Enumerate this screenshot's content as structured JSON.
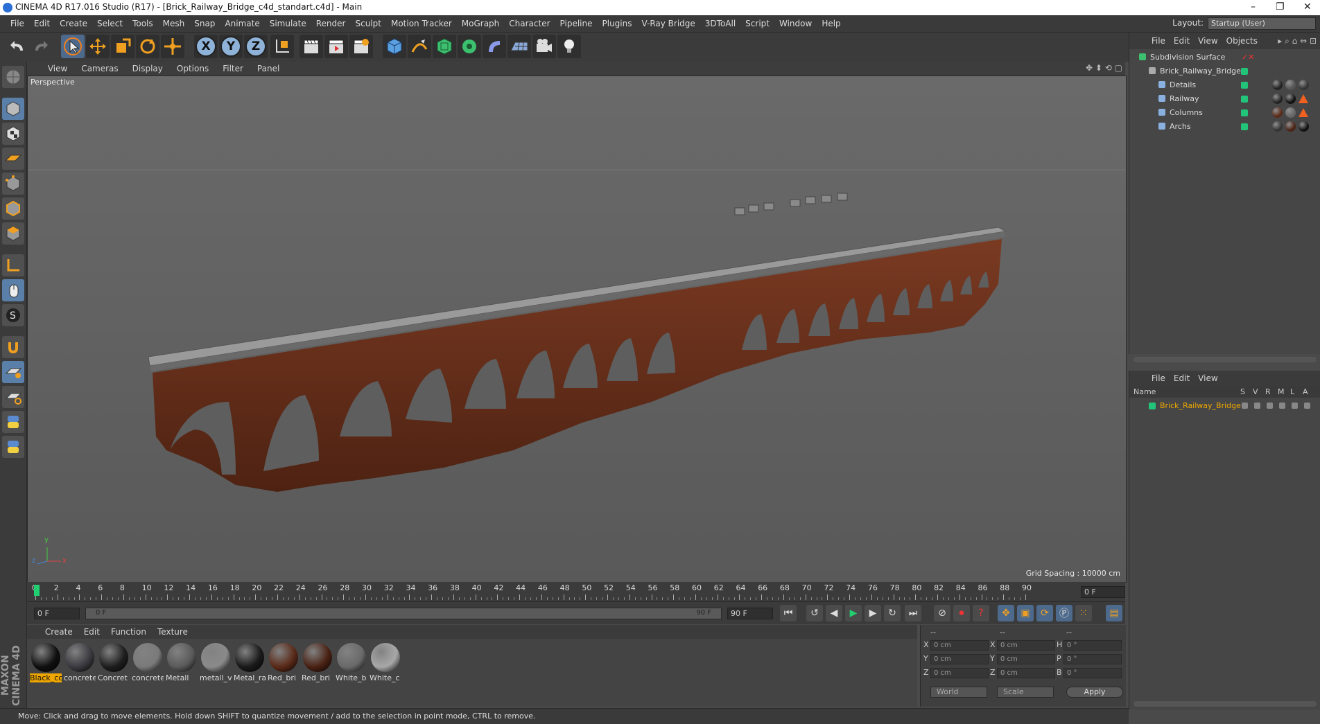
{
  "window": {
    "title": "CINEMA 4D R17.016 Studio (R17) - [Brick_Railway_Bridge_c4d_standart.c4d] - Main",
    "minimize": "–",
    "restore": "❐",
    "close": "✕"
  },
  "menu": [
    "File",
    "Edit",
    "Create",
    "Select",
    "Tools",
    "Mesh",
    "Snap",
    "Animate",
    "Simulate",
    "Render",
    "Sculpt",
    "Motion Tracker",
    "MoGraph",
    "Character",
    "Pipeline",
    "Plugins",
    "V-Ray Bridge",
    "3DToAll",
    "Script",
    "Window",
    "Help"
  ],
  "layout": {
    "label": "Layout:",
    "value": "Startup (User)"
  },
  "toolbar": {
    "x": "X",
    "y": "Y",
    "z": "Z"
  },
  "viewport": {
    "menu": [
      "View",
      "Cameras",
      "Display",
      "Options",
      "Filter",
      "Panel"
    ],
    "camera_label": "Perspective",
    "grid_spacing": "Grid Spacing : 10000 cm",
    "axis_y": "y",
    "axis_z": "z",
    "axis_x": "x"
  },
  "timeline": {
    "ticks": [
      "0",
      "2",
      "4",
      "6",
      "8",
      "10",
      "12",
      "14",
      "16",
      "18",
      "20",
      "22",
      "24",
      "26",
      "28",
      "30",
      "32",
      "34",
      "36",
      "38",
      "40",
      "42",
      "44",
      "46",
      "48",
      "50",
      "52",
      "54",
      "56",
      "58",
      "60",
      "62",
      "64",
      "66",
      "68",
      "70",
      "72",
      "74",
      "76",
      "78",
      "80",
      "82",
      "84",
      "86",
      "88",
      "90"
    ],
    "current_frame": "0 F",
    "start_frame": "0 F",
    "range_start": "0 F",
    "range_end": "90 F",
    "end_frame": "90 F",
    "progress": 0
  },
  "materials": {
    "menu": [
      "Create",
      "Edit",
      "Function",
      "Texture"
    ],
    "items": [
      {
        "label": "Black_cc",
        "color": "#101010",
        "selected": true
      },
      {
        "label": "concrete",
        "color": "#3a3a40"
      },
      {
        "label": "Concret",
        "color": "#1e1e1e"
      },
      {
        "label": "concrete",
        "color": "#7a7a7a"
      },
      {
        "label": "Metall",
        "color": "#5a5a5a"
      },
      {
        "label": "metall_v",
        "color": "#8a8a8a"
      },
      {
        "label": "Metal_ra",
        "color": "#1a1a1a"
      },
      {
        "label": "Red_bri",
        "color": "#5a2a18"
      },
      {
        "label": "Red_bri",
        "color": "#4a2214"
      },
      {
        "label": "White_b",
        "color": "#6a6a6a"
      },
      {
        "label": "White_c",
        "color": "#a8a8a8"
      }
    ]
  },
  "coords": {
    "header": [
      "--",
      "--",
      "--"
    ],
    "rows": [
      {
        "a": "X",
        "av": "0 cm",
        "b": "X",
        "bv": "0 cm",
        "c": "H",
        "cv": "0 °"
      },
      {
        "a": "Y",
        "av": "0 cm",
        "b": "Y",
        "bv": "0 cm",
        "c": "P",
        "cv": "0 °"
      },
      {
        "a": "Z",
        "av": "0 cm",
        "b": "Z",
        "bv": "0 cm",
        "c": "B",
        "cv": "0 °"
      }
    ],
    "world": "World",
    "scale": "Scale",
    "apply": "Apply"
  },
  "status": "Move: Click and drag to move elements. Hold down SHIFT to quantize movement / add to the selection in point mode, CTRL to remove.",
  "objects": {
    "menu": [
      "File",
      "Edit",
      "View",
      "Objects"
    ],
    "items": [
      {
        "name": "Subdivision Surface",
        "indent": 0
      },
      {
        "name": "Brick_Railway_Bridge",
        "indent": 1
      },
      {
        "name": "Details",
        "indent": 2
      },
      {
        "name": "Railway",
        "indent": 2
      },
      {
        "name": "Columns",
        "indent": 2
      },
      {
        "name": "Archs",
        "indent": 2
      }
    ]
  },
  "layers": {
    "menu": [
      "File",
      "Edit",
      "View"
    ],
    "header_name": "Name",
    "cols": [
      "S",
      "V",
      "R",
      "M",
      "L",
      "A"
    ],
    "items": [
      {
        "name": "Brick_Railway_Bridge"
      }
    ]
  },
  "colors": {
    "accent": "#f0a800",
    "green": "#22c47a",
    "brick": "#6b2f1a"
  }
}
